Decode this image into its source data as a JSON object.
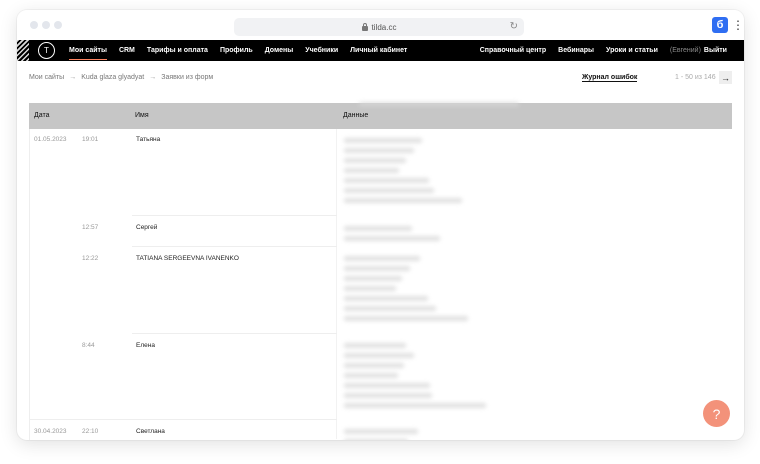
{
  "browser": {
    "url": "tilda.cc",
    "ext_label": "б",
    "menu_glyph": "⋮",
    "reload_glyph": "↻"
  },
  "nav": {
    "logo": "T",
    "left": [
      "Мои сайты",
      "CRM",
      "Тарифы и оплата",
      "Профиль",
      "Домены",
      "Учебники",
      "Личный кабинет"
    ],
    "right": [
      "Справочный центр",
      "Вебинары",
      "Уроки и статьи"
    ],
    "user": "(Евгений)",
    "logout": "Выйти"
  },
  "breadcrumb": {
    "items": [
      "Мои сайты",
      "Kuda glaza glyadyat",
      "Заявки из форм"
    ],
    "arrow": "→"
  },
  "error_log": "Журнал ошибок",
  "pager": {
    "text": "1 - 50 из 146",
    "next": "→"
  },
  "table": {
    "headers": {
      "date": "Дата",
      "name": "Имя",
      "data": "Данные"
    },
    "rows": [
      {
        "date": "01.05.2023",
        "time": "19:01",
        "name": "Татьяна"
      },
      {
        "date": "",
        "time": "12:57",
        "name": "Сергей"
      },
      {
        "date": "",
        "time": "12:22",
        "name": "TATIANA SERGEEVNA IVANENKO"
      },
      {
        "date": "",
        "time": "8:44",
        "name": "Елена"
      },
      {
        "date": "30.04.2023",
        "time": "22:10",
        "name": "Светлана"
      }
    ]
  },
  "help": "?"
}
